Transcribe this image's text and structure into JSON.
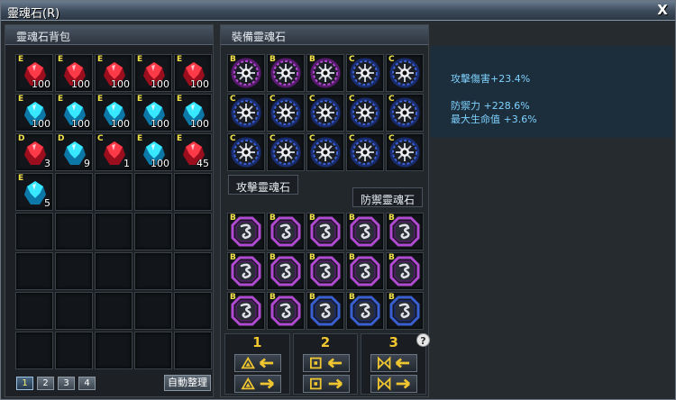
{
  "window": {
    "title": "靈魂石(R)",
    "close_label": "X"
  },
  "inventory": {
    "title": "靈魂石背包",
    "items": [
      {
        "grade": "E",
        "qty": "100",
        "color": "red"
      },
      {
        "grade": "E",
        "qty": "100",
        "color": "red"
      },
      {
        "grade": "E",
        "qty": "100",
        "color": "red"
      },
      {
        "grade": "E",
        "qty": "100",
        "color": "red"
      },
      {
        "grade": "E",
        "qty": "100",
        "color": "red"
      },
      {
        "grade": "E",
        "qty": "100",
        "color": "blue"
      },
      {
        "grade": "E",
        "qty": "100",
        "color": "blue"
      },
      {
        "grade": "E",
        "qty": "100",
        "color": "blue"
      },
      {
        "grade": "E",
        "qty": "100",
        "color": "blue"
      },
      {
        "grade": "E",
        "qty": "100",
        "color": "blue"
      },
      {
        "grade": "D",
        "qty": "3",
        "color": "red"
      },
      {
        "grade": "D",
        "qty": "9",
        "color": "blue"
      },
      {
        "grade": "C",
        "qty": "1",
        "color": "red"
      },
      {
        "grade": "E",
        "qty": "100",
        "color": "blue"
      },
      {
        "grade": "E",
        "qty": "45",
        "color": "red"
      },
      {
        "grade": "E",
        "qty": "5",
        "color": "blue"
      }
    ],
    "total_slots": 40,
    "pages": [
      "1",
      "2",
      "3",
      "4"
    ],
    "active_page": "1",
    "sort_label": "自動整理"
  },
  "equipped": {
    "title": "裝備靈魂石",
    "attack_tab": "攻擊靈魂石",
    "defense_tab": "防禦靈魂石",
    "attack_grades": [
      "B",
      "B",
      "B",
      "C",
      "C",
      "C",
      "C",
      "C",
      "C",
      "C",
      "C",
      "C",
      "C",
      "C",
      "C"
    ],
    "defense_grades": [
      "B",
      "B",
      "B",
      "B",
      "B",
      "B",
      "B",
      "B",
      "B",
      "B",
      "B",
      "B",
      "B",
      "B",
      "B"
    ],
    "defense_frames": [
      "purple",
      "purple",
      "purple",
      "purple",
      "purple",
      "purple",
      "purple",
      "purple",
      "purple",
      "purple",
      "purple",
      "purple",
      "blue",
      "blue",
      "blue"
    ],
    "presets": [
      "1",
      "2",
      "3"
    ],
    "preset_symbols": [
      "triangle",
      "square",
      "bowtie"
    ],
    "help_label": "?"
  },
  "stats": {
    "attack_damage": "攻擊傷害+23.4%",
    "defense": "防禦力 +228.6%",
    "max_hp": "最大生命值 +3.6%"
  },
  "colors": {
    "accent": "#f0c630",
    "stat_text": "#7fd2ff",
    "grade": "#f2e34a"
  }
}
